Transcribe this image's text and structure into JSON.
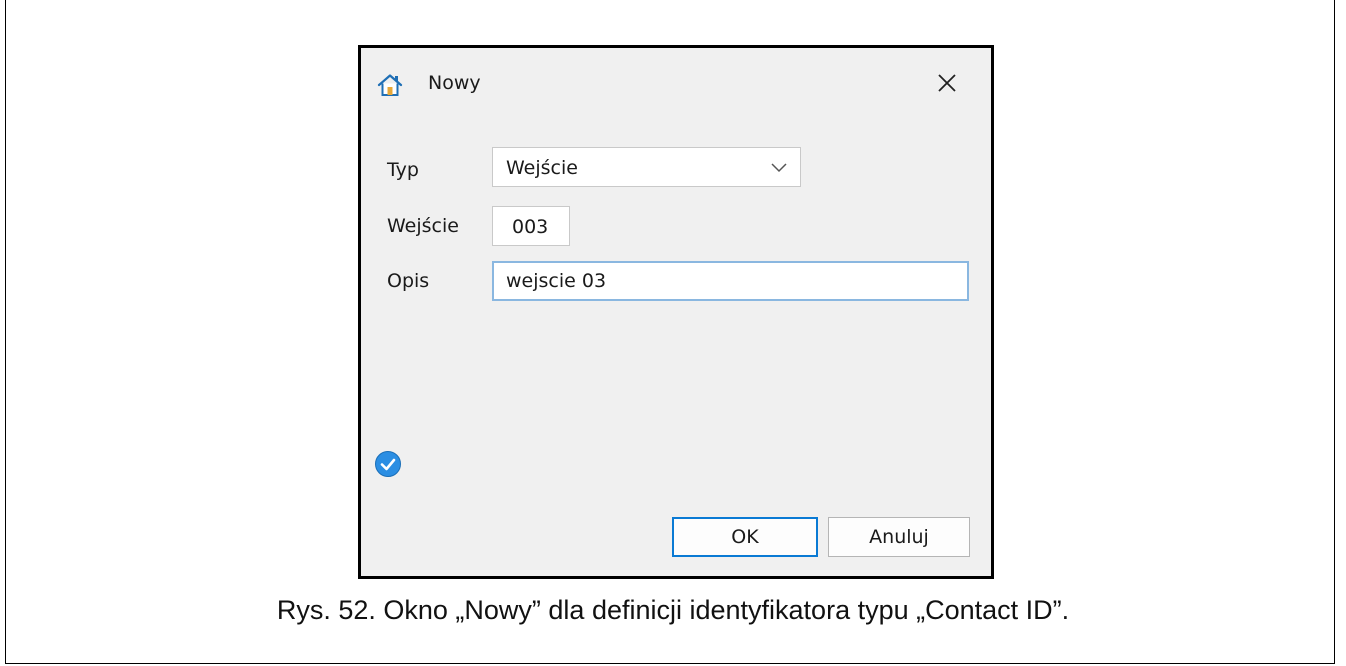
{
  "dialog": {
    "title": "Nowy",
    "title_icon": "home-icon",
    "close_icon": "close-icon",
    "status_icon": "check-circle-icon",
    "accent_color": "#0a7ad4"
  },
  "form": {
    "type": {
      "label": "Typ",
      "selected": "Wejście"
    },
    "input": {
      "label": "Wejście",
      "value": "003"
    },
    "description": {
      "label": "Opis",
      "value": "wejscie 03"
    }
  },
  "buttons": {
    "ok_label": "OK",
    "cancel_label": "Anuluj"
  },
  "caption": "Rys. 52. Okno „Nowy” dla definicji identyfikatora typu „Contact ID”."
}
